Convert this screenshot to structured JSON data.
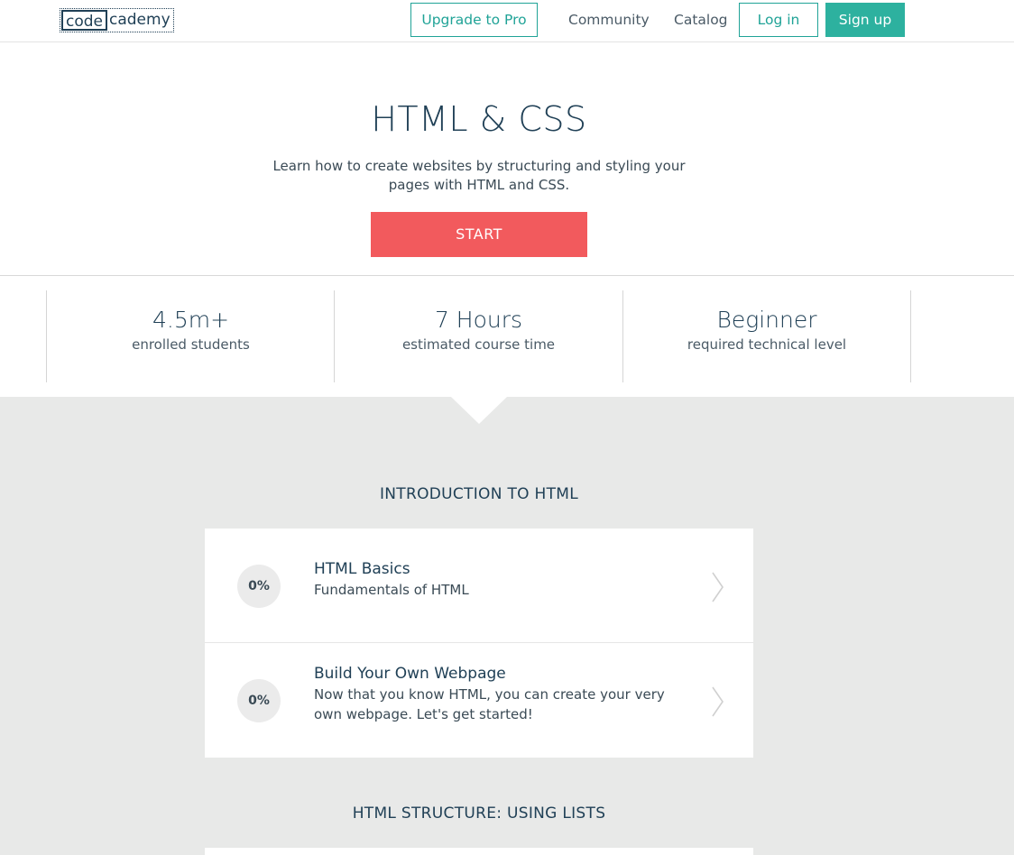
{
  "header": {
    "logo_code": "code",
    "logo_cademy": "cademy",
    "upgrade": "Upgrade to Pro",
    "community": "Community",
    "catalog": "Catalog",
    "login": "Log in",
    "signup": "Sign up"
  },
  "hero": {
    "title": "HTML & CSS",
    "description": "Learn how to create websites by structuring and styling your pages with HTML and CSS.",
    "start": "START"
  },
  "stats": [
    {
      "value": "4.5m+",
      "label": "enrolled students"
    },
    {
      "value": "7 Hours",
      "label": "estimated course time"
    },
    {
      "value": "Beginner",
      "label": "required technical level"
    }
  ],
  "sections": [
    {
      "title": "INTRODUCTION TO HTML",
      "lessons": [
        {
          "progress": "0%",
          "title": "HTML Basics",
          "subtitle": "Fundamentals of HTML"
        },
        {
          "progress": "0%",
          "title": "Build Your Own Webpage",
          "subtitle": "Now that you know HTML, you can create your very own webpage. Let's get started!"
        }
      ]
    },
    {
      "title": "HTML STRUCTURE: USING LISTS",
      "lessons": []
    }
  ],
  "colors": {
    "teal": "#2db19f",
    "start_red": "#f25a5d",
    "gray_bg": "#e8e9e8",
    "navy": "#204056"
  }
}
